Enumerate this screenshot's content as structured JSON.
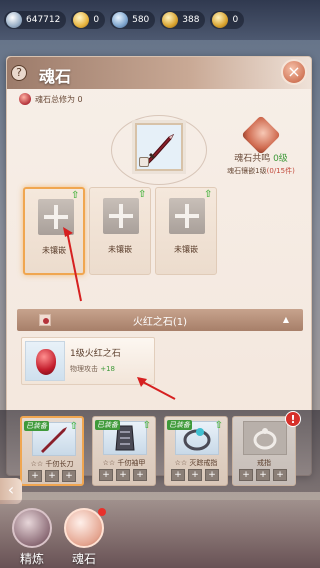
{
  "currencies": [
    {
      "icon": "silver-coin-icon",
      "value": "647712"
    },
    {
      "icon": "gold-coin-icon",
      "value": "0"
    },
    {
      "icon": "jade-icon",
      "value": "580"
    },
    {
      "icon": "gold-ingot-icon",
      "value": "388"
    },
    {
      "icon": "gold-ingot-icon",
      "value": "0"
    }
  ],
  "panel": {
    "help": "?",
    "title": "魂石",
    "close": "×",
    "total_cultivation": "魂石总修为 0",
    "resonance": {
      "title_prefix": "魂石共鸣 ",
      "level": "0级",
      "sub_prefix": "魂石镶嵌1级",
      "count": "(0/15件)"
    },
    "slots": [
      {
        "label": "未镶嵌"
      },
      {
        "label": "未镶嵌"
      },
      {
        "label": "未镶嵌"
      }
    ],
    "section_title": "火红之石(1)",
    "gem": {
      "name": "1级火红之石",
      "stat_label": "物理攻击 ",
      "stat_value": "+18"
    }
  },
  "equipment": [
    {
      "badge": "已装备",
      "name": "☆☆ 千仞长刀",
      "active": true
    },
    {
      "badge": "已装备",
      "name": "☆☆ 千仞袖甲",
      "active": false
    },
    {
      "badge": "已装备",
      "name": "☆☆ 灭踪戒指",
      "active": false
    },
    {
      "badge": "",
      "name": "戒指",
      "active": false,
      "alert": "!"
    }
  ],
  "bottom_tabs": [
    {
      "label": "精炼"
    },
    {
      "label": "魂石"
    }
  ],
  "colors": {
    "accent_orange": "#f0a650",
    "green": "#3f9a3a",
    "red": "#d6302a"
  }
}
